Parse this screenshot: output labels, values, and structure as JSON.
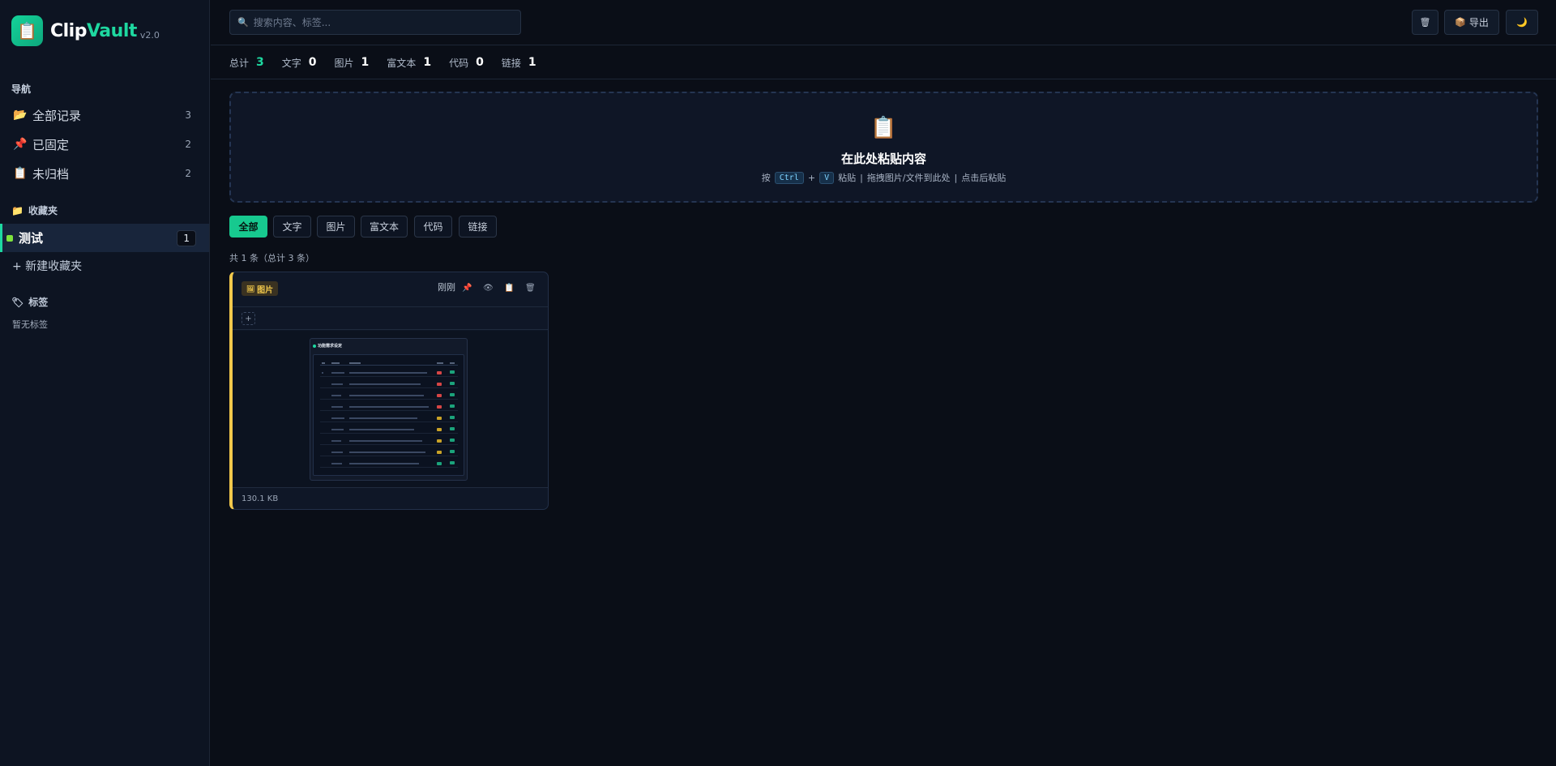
{
  "brand": {
    "name_prefix": "Clip",
    "name_accent": "Vault",
    "version": "v2.0"
  },
  "sidebar": {
    "nav_heading": "导航",
    "nav_items": [
      {
        "label": "全部记录",
        "count": "3",
        "icon": "folder-open-icon"
      },
      {
        "label": "已固定",
        "count": "2",
        "icon": "pushpin-icon"
      },
      {
        "label": "未归档",
        "count": "2",
        "icon": "clipboard-icon"
      }
    ],
    "folders_heading": "收藏夹",
    "folders": [
      {
        "label": "测试",
        "count": "1",
        "color": "#7ee33c"
      }
    ],
    "new_folder": "+ 新建收藏夹",
    "tags_heading": "标签",
    "no_tags": "暂无标签"
  },
  "topbar": {
    "search_placeholder": "搜索内容、标签...",
    "export_label": "导出"
  },
  "stats": [
    {
      "label": "总计",
      "value": "3"
    },
    {
      "label": "文字",
      "value": "0"
    },
    {
      "label": "图片",
      "value": "1"
    },
    {
      "label": "富文本",
      "value": "1"
    },
    {
      "label": "代码",
      "value": "0"
    },
    {
      "label": "链接",
      "value": "1"
    }
  ],
  "dropzone": {
    "title": "在此处粘贴内容",
    "hint_press": "按",
    "key_ctrl": "Ctrl",
    "plus": "+",
    "key_v": "V",
    "hint_paste": "粘贴",
    "sep": "|",
    "hint_drag": "拖拽图片/文件到此处",
    "hint_click": "点击后粘贴"
  },
  "filters": [
    "全部",
    "文字",
    "图片",
    "富文本",
    "代码",
    "链接"
  ],
  "active_filter": "全部",
  "list": {
    "count_text": "共 1 条（总计 3 条）"
  },
  "card": {
    "type_label": "图片",
    "time": "刚刚",
    "add_tag": "+",
    "size": "130.1 KB",
    "thumbnail_title": "功能需求设定",
    "accent_color": "#f2c94c"
  },
  "colors": {
    "accent": "#1ed8a0",
    "background": "#0a0e17",
    "sidebar": "#0d1422"
  }
}
